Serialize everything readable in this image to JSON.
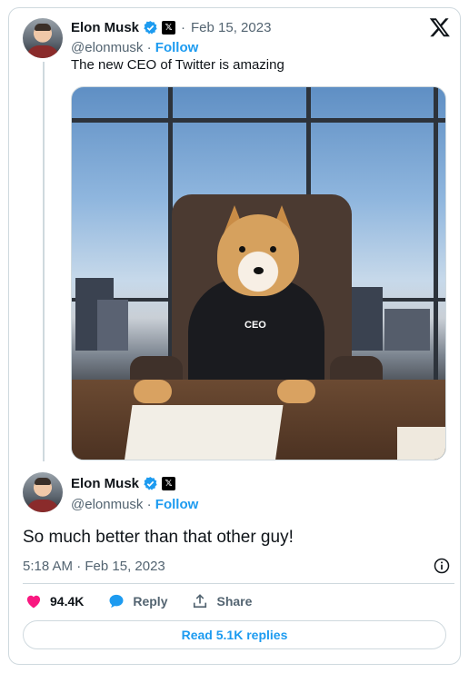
{
  "tweet1": {
    "name": "Elon Musk",
    "handle": "@elonmusk",
    "separator": "·",
    "date": "Feb 15, 2023",
    "follow": "Follow",
    "text": "The new CEO of Twitter is amazing",
    "photo_shirt_text": "CEO"
  },
  "tweet2": {
    "name": "Elon Musk",
    "handle": "@elonmusk",
    "separator": "·",
    "follow": "Follow",
    "text": "So much better than that other guy!",
    "timestamp": "5:18 AM · Feb 15, 2023"
  },
  "actions": {
    "like_count": "94.4K",
    "reply_label": "Reply",
    "share_label": "Share"
  },
  "read_replies": "Read 5.1K replies",
  "colors": {
    "accent": "#1d9bf0",
    "like": "#f91880",
    "muted": "#536471",
    "border": "#cfd9de"
  },
  "icons": [
    "x-logo-icon",
    "verified-badge-icon",
    "x-affiliate-icon",
    "heart-icon",
    "reply-bubble-icon",
    "share-icon",
    "info-icon"
  ]
}
